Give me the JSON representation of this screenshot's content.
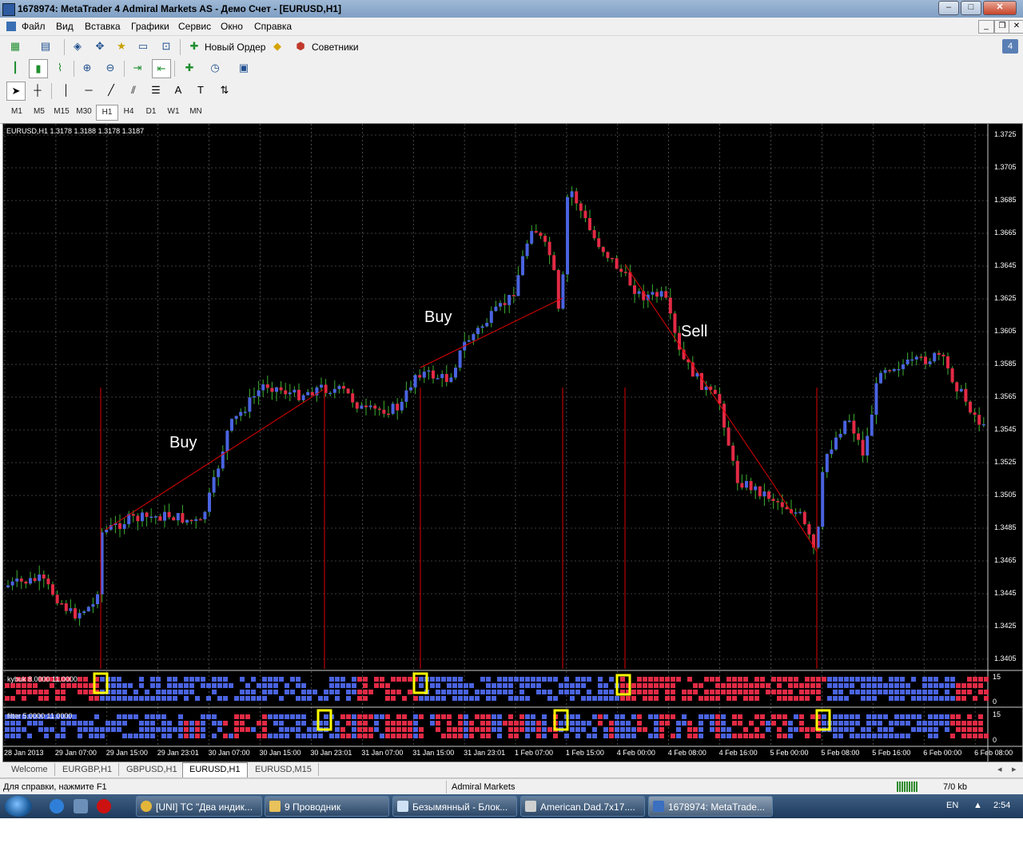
{
  "window": {
    "title": "1678974: MetaTrader 4 Admiral Markets AS - Демо Счет - [EURUSD,H1]",
    "controls": [
      "min",
      "max",
      "close"
    ]
  },
  "menu": [
    "Файл",
    "Вид",
    "Вставка",
    "Графики",
    "Сервис",
    "Окно",
    "Справка"
  ],
  "toolbar": {
    "new_order": "Новый Ордер",
    "experts": "Советники",
    "badge": "4"
  },
  "timeframes": [
    "M1",
    "M5",
    "M15",
    "M30",
    "H1",
    "H4",
    "D1",
    "W1",
    "MN"
  ],
  "timeframe_selected": "H1",
  "chart": {
    "header": "EURUSD,H1  1.3178 1.3188 1.3178 1.3187",
    "price_ticks": [
      "1.3725",
      "1.3705",
      "1.3685",
      "1.3665",
      "1.3645",
      "1.3625",
      "1.3605",
      "1.3585",
      "1.3565",
      "1.3545",
      "1.3525",
      "1.3505",
      "1.3485",
      "1.3465",
      "1.3445",
      "1.3425",
      "1.3405"
    ],
    "annotations": [
      "Buy",
      "Buy",
      "Sell"
    ],
    "indicator1": {
      "label": "kybuk 8.0000 11.0000",
      "scale": [
        "15",
        "0"
      ]
    },
    "indicator2": {
      "label": "filter 5.0000 11.0000",
      "scale": [
        "15",
        "0"
      ]
    },
    "time_ticks": [
      "28 Jan 2013",
      "29 Jan 07:00",
      "29 Jan 15:00",
      "29 Jan 23:01",
      "30 Jan 07:00",
      "30 Jan 15:00",
      "30 Jan 23:01",
      "31 Jan 07:00",
      "31 Jan 15:00",
      "31 Jan 23:01",
      "1 Feb 07:00",
      "1 Feb 15:00",
      "4 Feb 00:00",
      "4 Feb 08:00",
      "4 Feb 16:00",
      "5 Feb 00:00",
      "5 Feb 08:00",
      "5 Feb 16:00",
      "6 Feb 00:00",
      "6 Feb 08:00"
    ],
    "colors": {
      "bull": "#4a63e0",
      "bear": "#e22a45",
      "wick": "#3cb031",
      "trend": "#e00000",
      "marker": "#ffff00"
    }
  },
  "chart_tabs": [
    "Welcome",
    "EURGBP,H1",
    "GBPUSD,H1",
    "EURUSD,H1",
    "EURUSD,M15"
  ],
  "chart_tab_active": "EURUSD,H1",
  "status": {
    "help": "Для справки, нажмите F1",
    "broker": "Admiral Markets",
    "traffic": "7/0 kb"
  },
  "taskbar": {
    "tasks": [
      "[UNI] ТС \"Два индик...",
      "9 Проводник",
      "Безымянный - Блок...",
      "American.Dad.7x17....",
      "1678974: MetaTrade..."
    ],
    "lang": "EN",
    "time": "2:54"
  }
}
